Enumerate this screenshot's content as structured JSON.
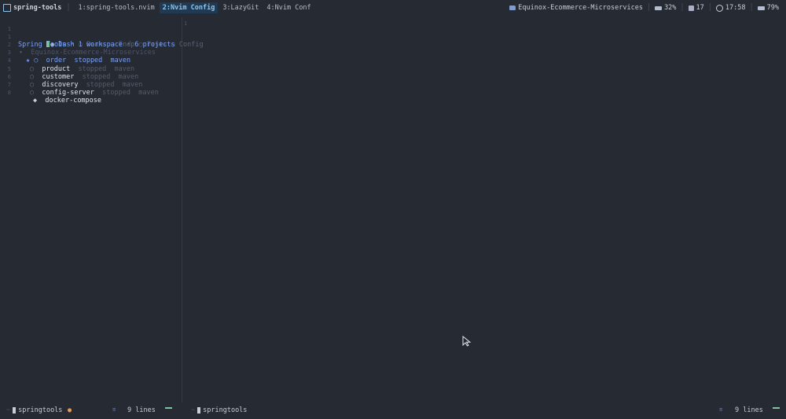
{
  "topbar": {
    "session_name": "spring-tools",
    "windows": [
      {
        "label": "1:spring-tools.nvim",
        "active": false
      },
      {
        "label": "2:Nvim Config",
        "active": true
      },
      {
        "label": "3:LazyGit",
        "active": false
      },
      {
        "label": "4:Nvim Conf",
        "active": false
      }
    ],
    "status": {
      "project": "Equinox-Ecommerce-Microservices",
      "cpu": "32%",
      "date": "17",
      "time": "17:58",
      "battery": "79%"
    }
  },
  "left_pane": {
    "tabs": {
      "active": "Dash",
      "others": [
        "Beans",
        "Endp",
        "Tests",
        "Config"
      ]
    },
    "header": "Spring Tools · 1 workspace · 6 projects",
    "workspace": "Equinox-Ecommerce-Microservices",
    "projects": [
      {
        "name": "order",
        "status": "stopped",
        "type": "maven",
        "selected": true
      },
      {
        "name": "product",
        "status": "stopped",
        "type": "maven",
        "selected": false
      },
      {
        "name": "customer",
        "status": "stopped",
        "type": "maven",
        "selected": false
      },
      {
        "name": "discovery",
        "status": "stopped",
        "type": "maven",
        "selected": false
      },
      {
        "name": "config-server",
        "status": "stopped",
        "type": "maven",
        "selected": false
      }
    ],
    "compose": "docker-compose",
    "line_numbers": [
      "1",
      "1",
      "2",
      "3",
      "4",
      "5",
      "6",
      "7",
      "8"
    ]
  },
  "right_pane": {
    "line_number": "1"
  },
  "statusline": {
    "left_file": "springtools",
    "left_lines": "9 lines",
    "right_file": "springtools",
    "right_lines": "9 lines",
    "mode_glyph": "≡",
    "dash": "~",
    "mod_glyph": "●"
  }
}
